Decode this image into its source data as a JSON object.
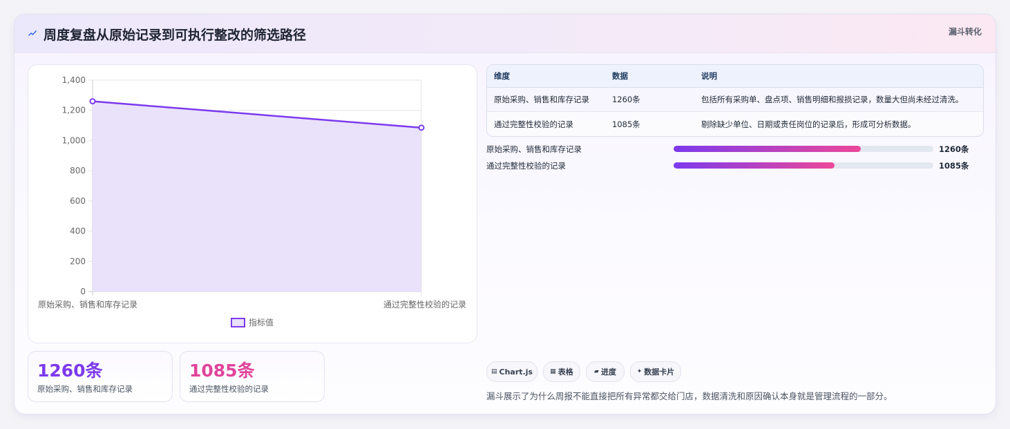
{
  "header": {
    "title": "周度复盘从原始记录到可执行整改的筛选路径",
    "tag": "漏斗转化",
    "icon": "trend-icon"
  },
  "chart_data": {
    "type": "line",
    "categories": [
      "原始采购、销售和库存记录",
      "通过完整性校验的记录"
    ],
    "series": [
      {
        "name": "指标值",
        "values": [
          1260,
          1085
        ]
      }
    ],
    "ylim": [
      0,
      1400
    ],
    "yticks": [
      "0",
      "200",
      "400",
      "600",
      "800",
      "1,000",
      "1,200",
      "1,400"
    ],
    "legend_position": "bottom",
    "colors": {
      "line": "#7c3aed",
      "fill": "#e9e0fb"
    }
  },
  "stats": [
    {
      "value": "1260条",
      "label": "原始采购、销售和库存记录",
      "color": "#7c3aed"
    },
    {
      "value": "1085条",
      "label": "通过完整性校验的记录",
      "color": "#e0449a"
    }
  ],
  "table": {
    "headers": [
      "维度",
      "数据",
      "说明"
    ],
    "rows": [
      [
        "原始采购、销售和库存记录",
        "1260条",
        "包括所有采购单、盘点项、销售明细和报损记录，数量大但尚未经过清洗。"
      ],
      [
        "通过完整性校验的记录",
        "1085条",
        "剔除缺少单位、日期或责任岗位的记录后，形成可分析数据。"
      ]
    ]
  },
  "progress": [
    {
      "label": "原始采购、销售和库存记录",
      "value_text": "1260条",
      "value": 1260,
      "max": 1750
    },
    {
      "label": "通过完整性校验的记录",
      "value_text": "1085条",
      "value": 1085,
      "max": 1750
    }
  ],
  "pills": [
    {
      "icon": "▤",
      "label": "Chart.js"
    },
    {
      "icon": "▦",
      "label": "表格"
    },
    {
      "icon": "▰",
      "label": "进度"
    },
    {
      "icon": "✦",
      "label": "数据卡片"
    }
  ],
  "footnote": "漏斗展示了为什么周报不能直接把所有异常都交给门店，数据清洗和原因确认本身就是管理流程的一部分。"
}
